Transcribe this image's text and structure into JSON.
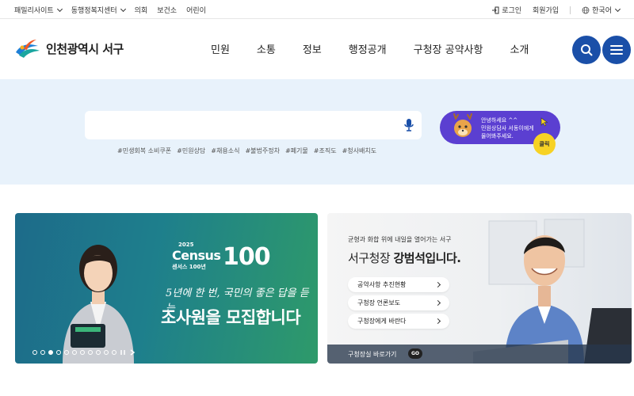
{
  "topbar": {
    "left": [
      {
        "label": "패밀리사이트",
        "has_dropdown": true
      },
      {
        "label": "동행정복지센터",
        "has_dropdown": true
      },
      {
        "label": "의회"
      },
      {
        "label": "보건소"
      },
      {
        "label": "어린이"
      }
    ],
    "login": "로그인",
    "signup": "회원가입",
    "language": "한국어"
  },
  "header": {
    "logo_text": "인천광역시 서구",
    "nav": [
      "민원",
      "소통",
      "정보",
      "행정공개",
      "구청장 공약사항",
      "소개"
    ],
    "search_icon": "search-icon",
    "menu_icon": "menu-icon"
  },
  "search": {
    "placeholder": "",
    "tags": [
      "#민생회복 소비쿠폰",
      "#민원상담",
      "#채용소식",
      "#불법주정차",
      "#폐기물",
      "#조직도",
      "#청사배치도"
    ]
  },
  "chatbot": {
    "line1": "안녕하세요 ^^",
    "line2": "민원상담사 서동이에게",
    "line3": "물어봐주세요.",
    "click": "클릭"
  },
  "banner": {
    "year": "2025",
    "census": "Census",
    "census_sub": "센서스 100년",
    "hundred": "100",
    "slogan": "5년에 한 번, 국민의 좋은 답을 듣는",
    "headline": "조사원을 모집합니다"
  },
  "mayor": {
    "caption": "균형과 화합 위에 내일을 열어가는 서구",
    "name_prefix": "서구청장 ",
    "name_bold": "강범석입니다.",
    "links": [
      "공약사항 추진현황",
      "구청장 언론보도",
      "구청장에게 바란다"
    ],
    "office": "구청장실 바로가기",
    "go": "GO"
  },
  "colors": {
    "brand": "#1a4fa8",
    "search_bg": "#e8f2fb",
    "chatbot": "#5b3fd1",
    "click": "#f7d224"
  }
}
